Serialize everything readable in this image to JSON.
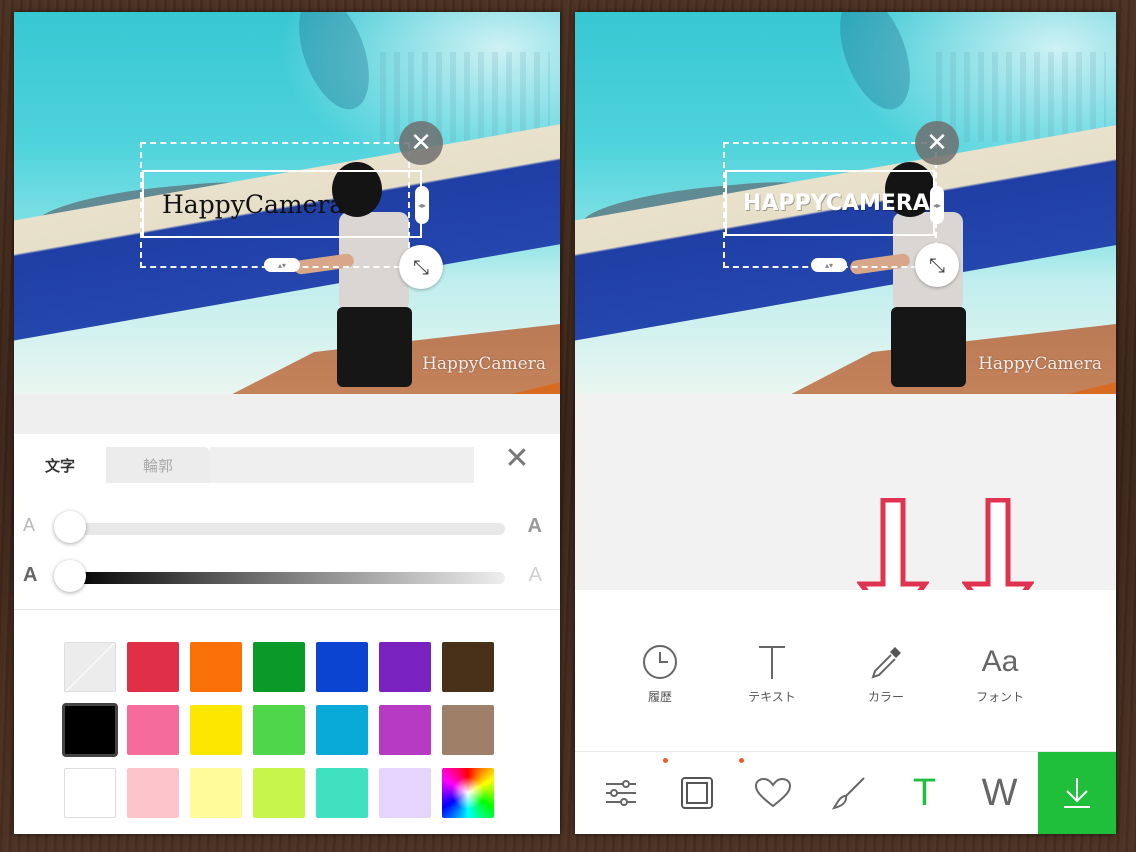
{
  "photo": {
    "overlay_text": "HappyCamera",
    "overlay_text_styled": "HAPPYCAMERA",
    "watermark": "HappyCamera",
    "close_glyph": "✕",
    "resize_glyph": "⤡"
  },
  "text_panel": {
    "tabs": [
      {
        "label": "文字",
        "active": true
      },
      {
        "label": "輪郭",
        "active": false
      }
    ],
    "close_glyph": "✕",
    "size_slider": {
      "min_label": "A",
      "max_label": "A",
      "value": 0.0
    },
    "opacity_slider": {
      "min_label": "A",
      "max_label": "A",
      "value": 0.0
    },
    "colors": [
      "#e8e8e8",
      "#e03048",
      "#f97008",
      "#0a9a2a",
      "#0a44d0",
      "#7a22bf",
      "#473118",
      "#000000",
      "#f56b9b",
      "#fde700",
      "#4fd64a",
      "#0aaad8",
      "#b73ac3",
      "#9e7f68",
      "#ffffff",
      "#fbc4ca",
      "#fffa9a",
      "#c8f54a",
      "#3fe1c0",
      "#e6d4fb",
      "spectrum"
    ],
    "selected_color": "#000000"
  },
  "editor": {
    "tools": [
      {
        "label": "履歴",
        "icon": "clock-icon"
      },
      {
        "label": "テキスト",
        "icon": "text-t-icon"
      },
      {
        "label": "カラー",
        "icon": "eyedropper-icon"
      },
      {
        "label": "フォント",
        "icon": "font-aa-icon",
        "glyph": "Aa"
      }
    ],
    "bottom_bar": [
      {
        "icon": "sliders-icon",
        "dot": false
      },
      {
        "icon": "frame-icon",
        "dot": true
      },
      {
        "icon": "heart-icon",
        "dot": true
      },
      {
        "icon": "brush-icon",
        "dot": false
      },
      {
        "icon": "text-icon",
        "glyph": "T",
        "active": true
      },
      {
        "icon": "watermark-icon",
        "glyph": "W",
        "active": false
      },
      {
        "icon": "download-icon"
      }
    ],
    "accent": "#1fbf3c",
    "arrow_color": "#e0334f"
  }
}
